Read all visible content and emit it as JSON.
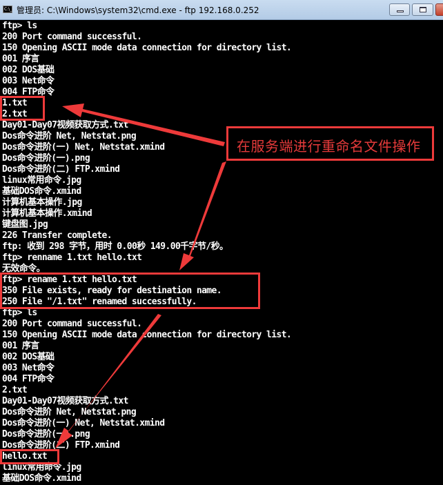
{
  "window": {
    "title": "管理员: C:\\Windows\\system32\\cmd.exe - ftp  192.168.0.252",
    "icon": "cmd-icon",
    "icon_text": "C:\\_",
    "controls": [
      "minimize",
      "maximize",
      "close"
    ]
  },
  "console": {
    "lines": [
      "ftp> ls",
      "200 Port command successful.",
      "150 Opening ASCII mode data connection for directory list.",
      "001 序言",
      "002 DOS基础",
      "003 Net命令",
      "004 FTP命令",
      "1.txt",
      "2.txt",
      "Day01-Day07视频获取方式.txt",
      "Dos命令进阶 Net, Netstat.png",
      "Dos命令进阶(一) Net, Netstat.xmind",
      "Dos命令进阶(一).png",
      "Dos命令进阶(二) FTP.xmind",
      "linux常用命令.jpg",
      "基础DOS命令.xmind",
      "计算机基本操作.jpg",
      "计算机基本操作.xmind",
      "键盘图.jpg",
      "226 Transfer complete.",
      "ftp: 收到 298 字节，用时 0.00秒 149.00千字节/秒。",
      "ftp> renname 1.txt hello.txt",
      "无效命令。",
      "ftp> rename 1.txt hello.txt",
      "350 File exists, ready for destination name.",
      "250 File \"/1.txt\" renamed successfully.",
      "ftp> ls",
      "200 Port command successful.",
      "150 Opening ASCII mode data connection for directory list.",
      "001 序言",
      "002 DOS基础",
      "003 Net命令",
      "004 FTP命令",
      "2.txt",
      "Day01-Day07视频获取方式.txt",
      "Dos命令进阶 Net, Netstat.png",
      "Dos命令进阶(一) Net, Netstat.xmind",
      "Dos命令进阶(一).png",
      "Dos命令进阶(二) FTP.xmind",
      "hello.txt",
      "linux常用命令.jpg",
      "基础DOS命令.xmind"
    ]
  },
  "annotation": {
    "callout_text": "在服务端进行重命名文件操作",
    "accent_color": "#ee3a3a"
  }
}
